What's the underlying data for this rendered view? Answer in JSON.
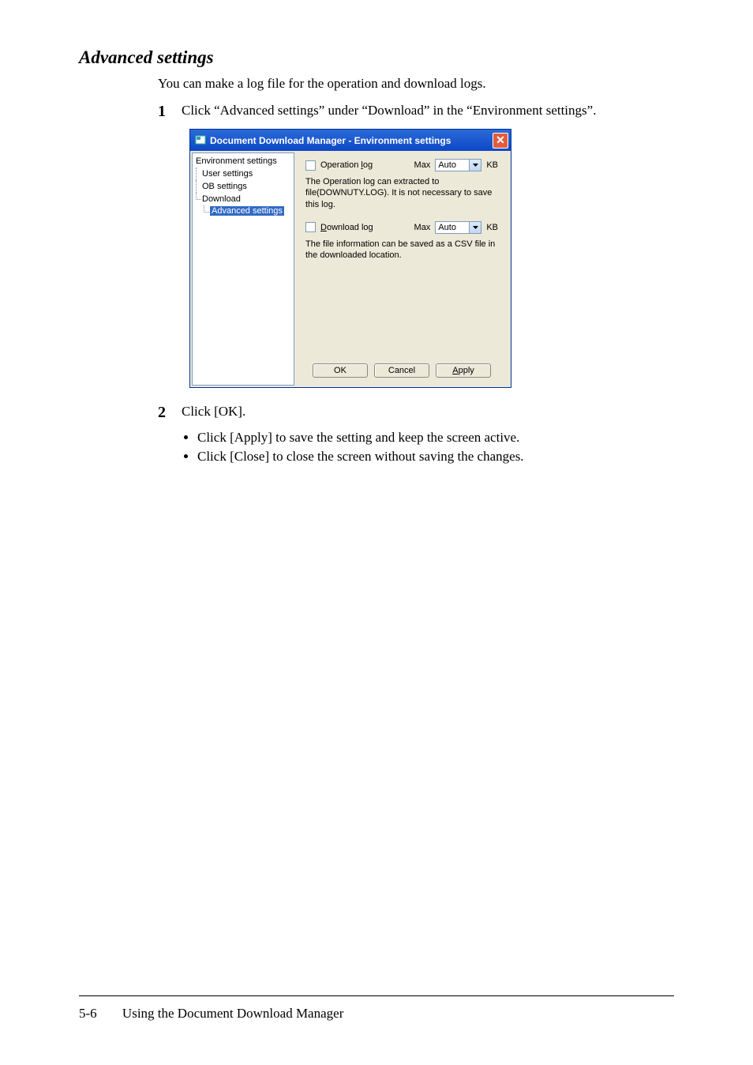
{
  "section_title": "Advanced settings",
  "intro": "You can make a log file for the operation and download logs.",
  "steps": {
    "s1_num": "1",
    "s1_text": "Click “Advanced settings” under “Download” in the “Environment settings”.",
    "s2_num": "2",
    "s2_text": "Click [OK]."
  },
  "dialog": {
    "title": "Document Download Manager - Environment settings",
    "tree": {
      "root": "Environment settings",
      "c1": "User settings",
      "c2": "OB settings",
      "c3": "Download",
      "gc1": "Advanced settings"
    },
    "op_label_pre": "Operation ",
    "op_label_u": "l",
    "op_label_post": "og",
    "dl_label_u": "D",
    "dl_label_post": "ownload log",
    "max_label": "Max",
    "kb_label": "KB",
    "combo_value": "Auto",
    "op_desc": "The Operation log can extracted to file(DOWNUTY.LOG). It is not necessary to save this log.",
    "dl_desc": "The file information can be saved as a CSV file in the downloaded location.",
    "btn_ok": "OK",
    "btn_cancel": "Cancel",
    "btn_apply_u": "A",
    "btn_apply_post": "pply"
  },
  "bullets": {
    "b1": "Click [Apply] to save the setting and keep the screen active.",
    "b2": "Click [Close] to close the screen without saving the changes."
  },
  "footer": {
    "page": "5-6",
    "title": "Using the Document Download Manager"
  }
}
